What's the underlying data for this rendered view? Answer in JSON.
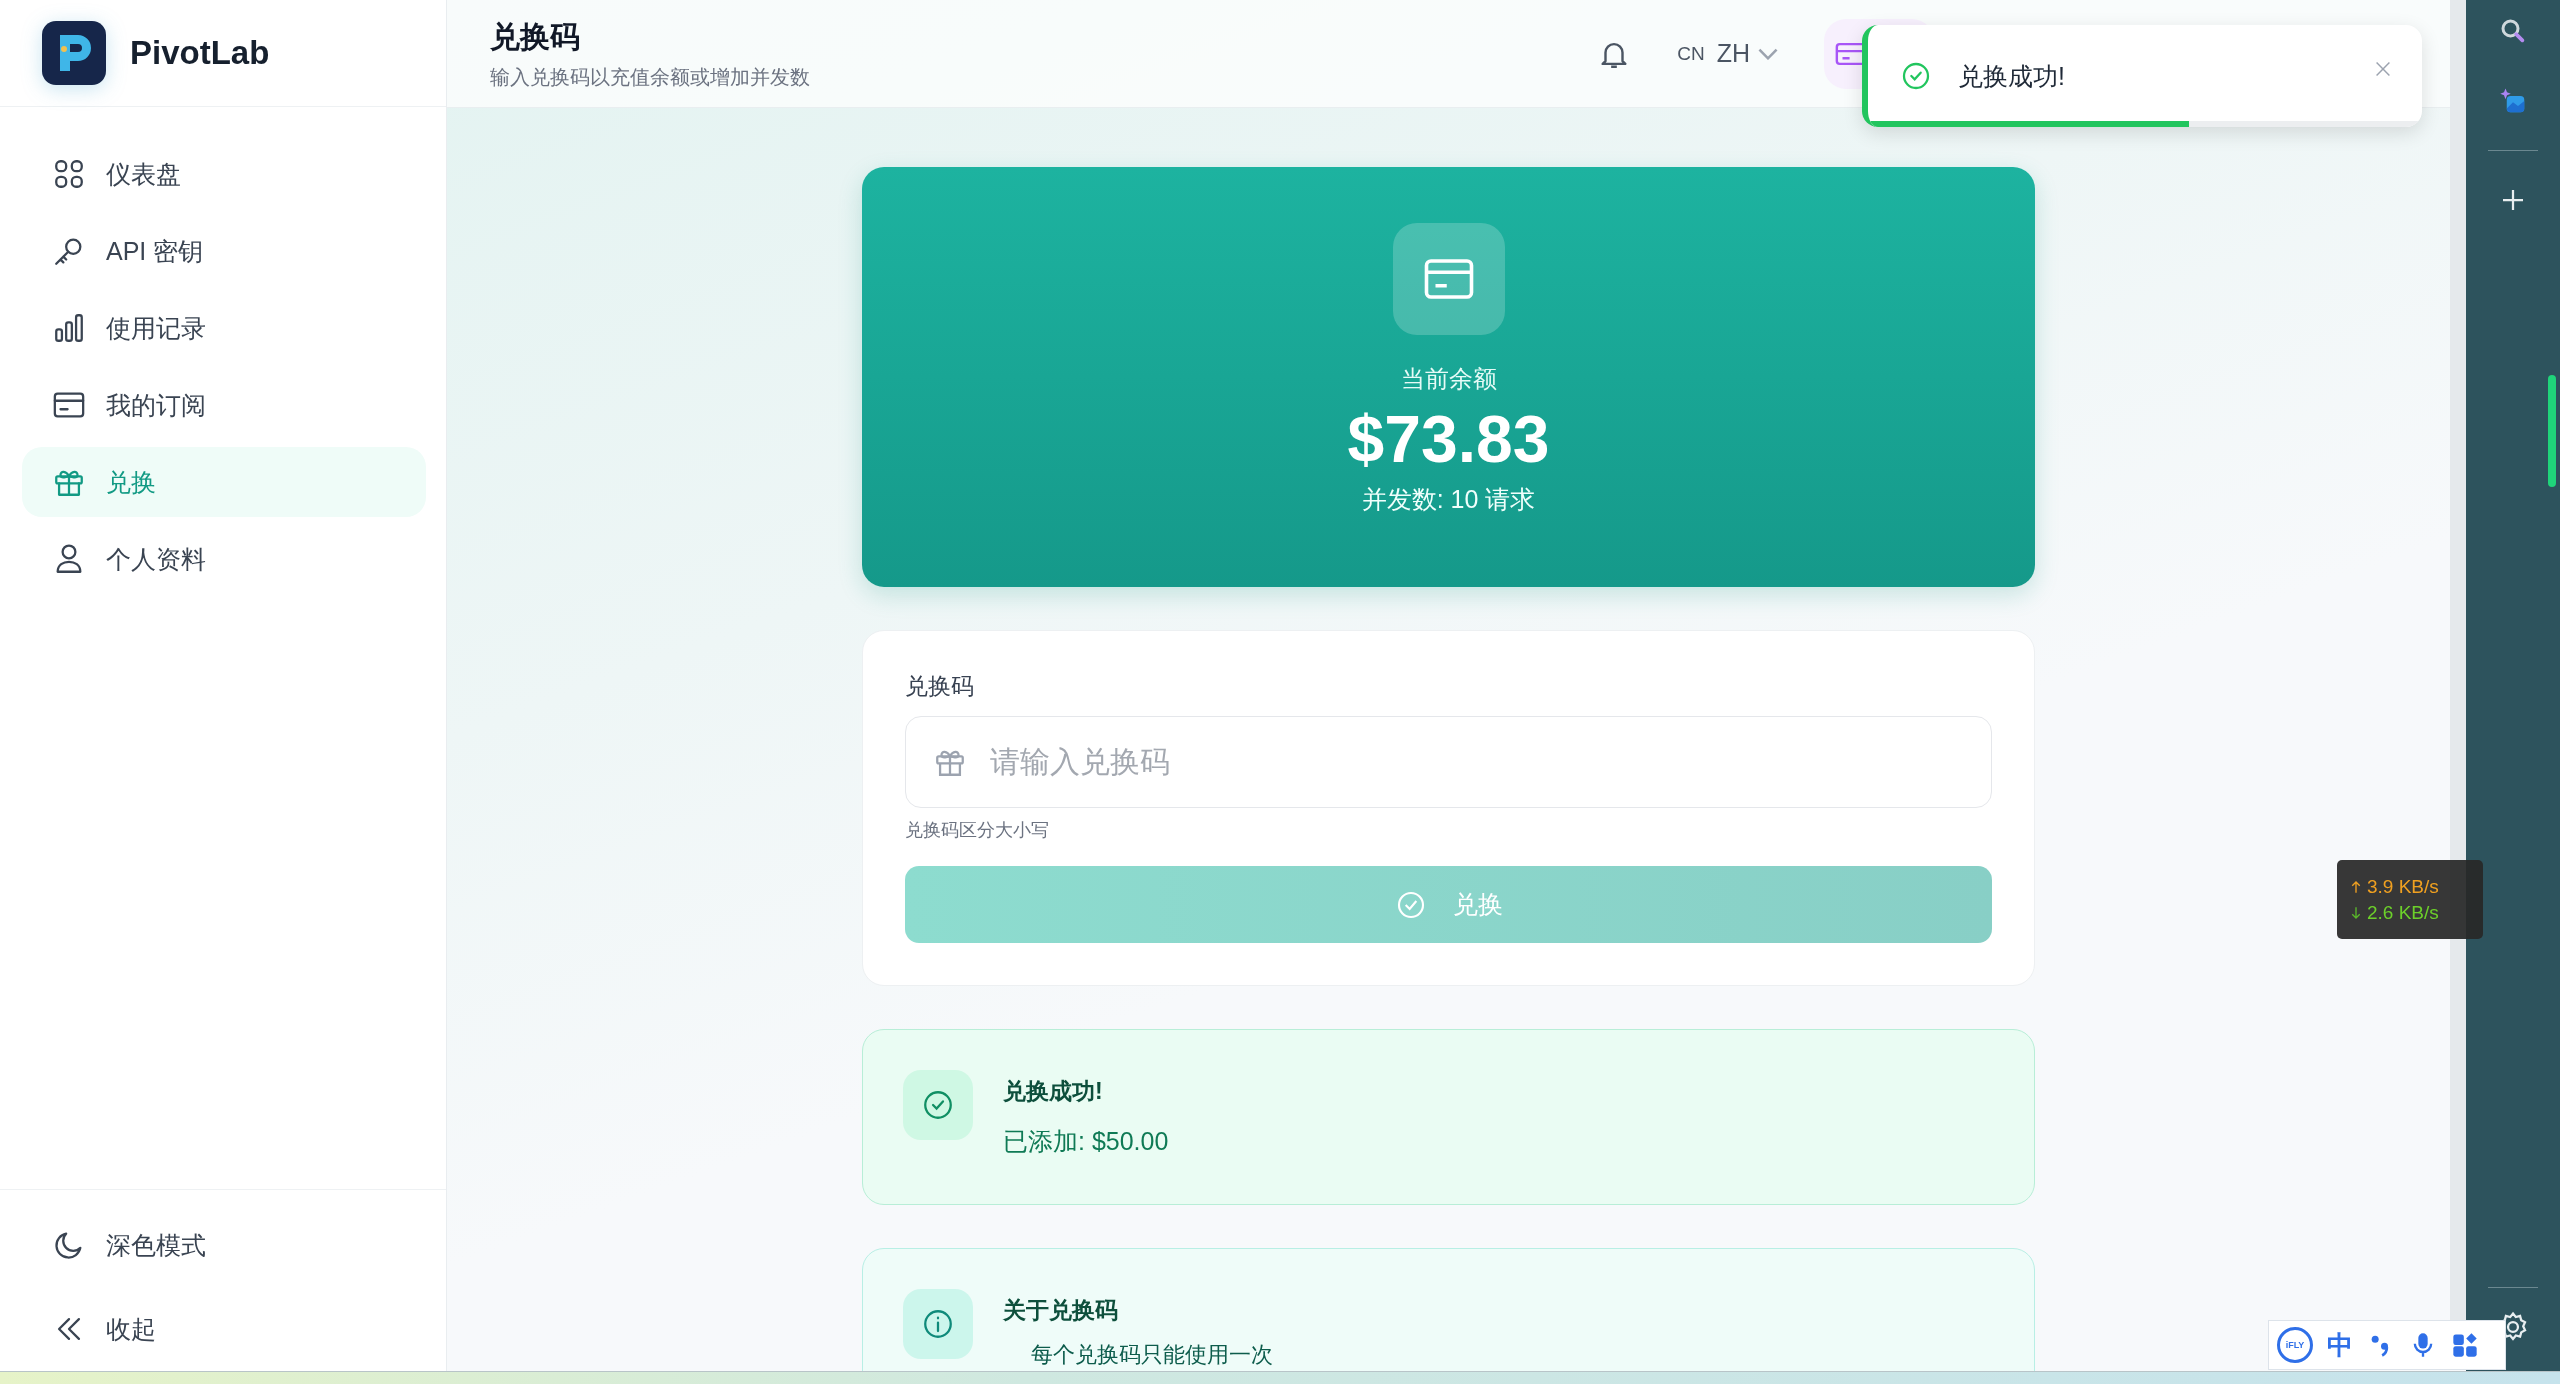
{
  "app": {
    "name": "PivotLab"
  },
  "sidebar": {
    "items": [
      {
        "label": "仪表盘",
        "selected": false
      },
      {
        "label": "API 密钥",
        "selected": false
      },
      {
        "label": "使用记录",
        "selected": false
      },
      {
        "label": "我的订阅",
        "selected": false
      },
      {
        "label": "兑换",
        "selected": true
      },
      {
        "label": "个人资料",
        "selected": false
      }
    ],
    "footer": [
      {
        "label": "深色模式"
      },
      {
        "label": "收起"
      }
    ]
  },
  "header": {
    "title": "兑换码",
    "subtitle": "输入兑换码以充值余额或增加并发数",
    "language": {
      "code": "CN",
      "label": "ZH"
    }
  },
  "toast": {
    "message": "兑换成功!",
    "level": 0.58
  },
  "balance": {
    "label": "当前余额",
    "amount": "$73.83",
    "concurrency": "并发数: 10 请求"
  },
  "redeem_form": {
    "label": "兑换码",
    "placeholder": "请输入兑换码",
    "hint": "兑换码区分大小写",
    "button": "兑换",
    "disabled": true
  },
  "result": {
    "title": "兑换成功!",
    "detail": "已添加: $50.00"
  },
  "info": {
    "title": "关于兑换码",
    "items": [
      "每个兑换码只能使用一次"
    ]
  },
  "network_monitor": {
    "upload": "3.9 KB/s",
    "download": "2.6 KB/s"
  },
  "ime_toolbar": {
    "logo": "iFLY",
    "mode": "中"
  }
}
